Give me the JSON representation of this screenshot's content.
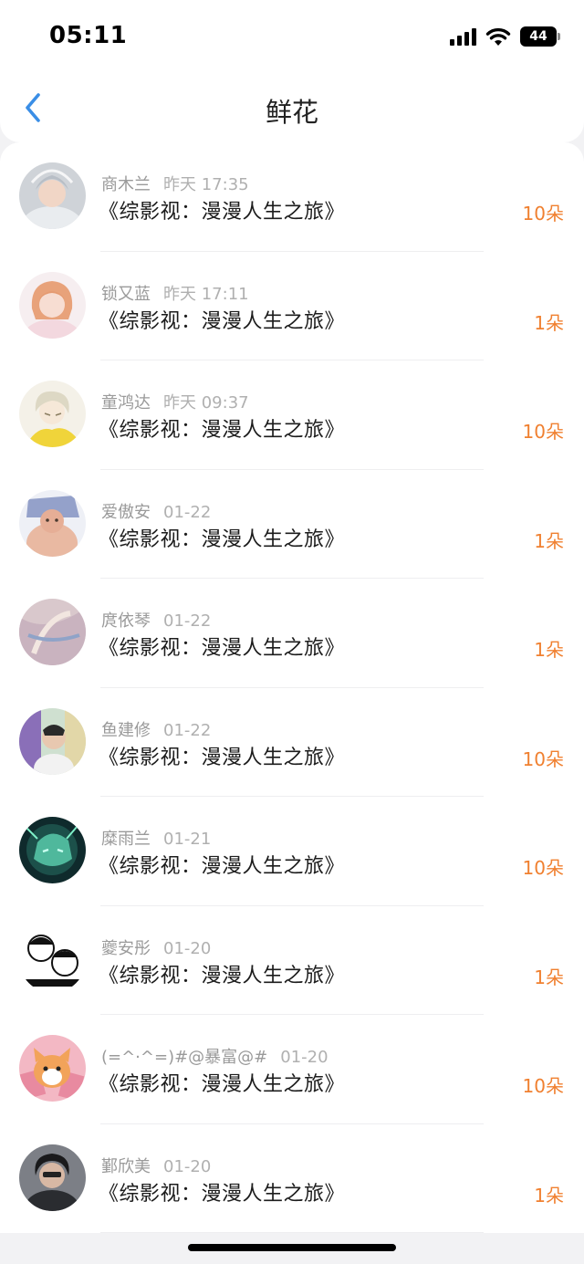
{
  "status_bar": {
    "time": "05:11",
    "battery": "44"
  },
  "nav": {
    "title": "鲜花",
    "back_icon": "chevron-left-icon",
    "accent_color": "#3a8ee6"
  },
  "rows": [
    {
      "name": "商木兰",
      "time": "昨天 17:35",
      "title": "《综影视：漫漫人生之旅》",
      "amount": "10朵"
    },
    {
      "name": "锁又蓝",
      "time": "昨天 17:11",
      "title": "《综影视：漫漫人生之旅》",
      "amount": "1朵"
    },
    {
      "name": "童鸿达",
      "time": "昨天 09:37",
      "title": "《综影视：漫漫人生之旅》",
      "amount": "10朵"
    },
    {
      "name": "爱傲安",
      "time": "01-22",
      "title": "《综影视：漫漫人生之旅》",
      "amount": "1朵"
    },
    {
      "name": "庹依琴",
      "time": "01-22",
      "title": "《综影视：漫漫人生之旅》",
      "amount": "1朵"
    },
    {
      "name": "鱼建修",
      "time": "01-22",
      "title": "《综影视：漫漫人生之旅》",
      "amount": "10朵"
    },
    {
      "name": "糜雨兰",
      "time": "01-21",
      "title": "《综影视：漫漫人生之旅》",
      "amount": "10朵"
    },
    {
      "name": "夔安彤",
      "time": "01-20",
      "title": "《综影视：漫漫人生之旅》",
      "amount": "1朵"
    },
    {
      "name": "(=^·^=)#@暴富@#",
      "time": "01-20",
      "title": "《综影视：漫漫人生之旅》",
      "amount": "10朵"
    },
    {
      "name": "鄞欣美",
      "time": "01-20",
      "title": "《综影视：漫漫人生之旅》",
      "amount": "1朵"
    }
  ],
  "colors": {
    "amount": "#f08030",
    "meta": "#9a9a9a"
  }
}
